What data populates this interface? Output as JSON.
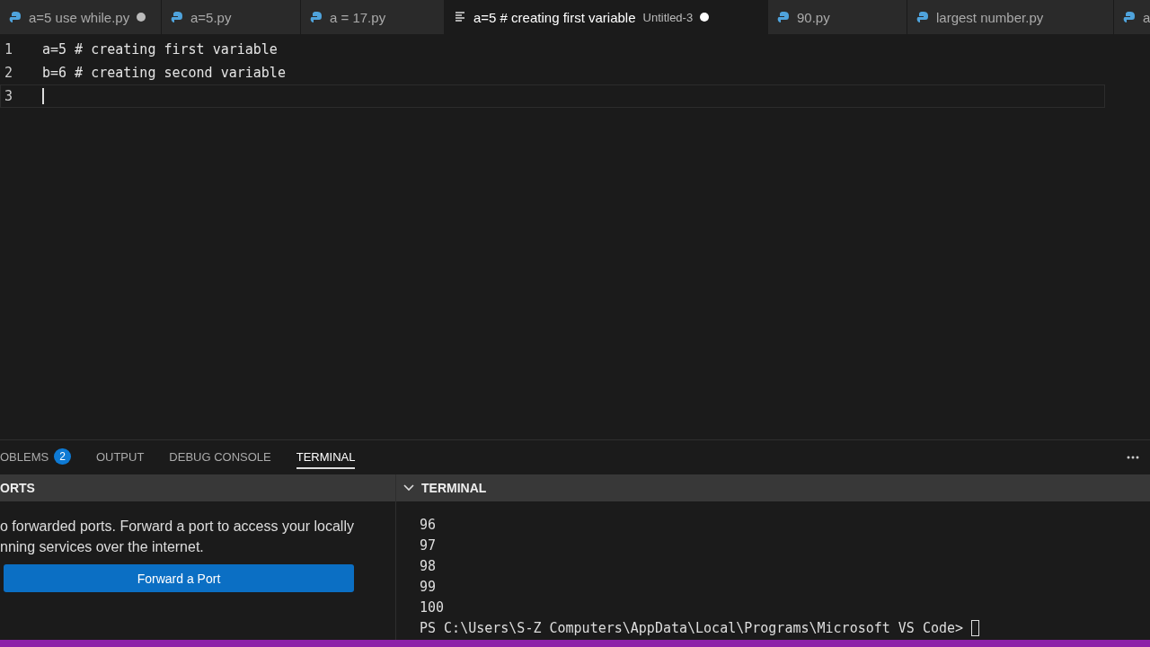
{
  "editor_tabs": [
    {
      "label": "a=5 use while.py",
      "kind": "python",
      "dirty": true,
      "selected": false
    },
    {
      "label": "a=5.py",
      "kind": "python",
      "dirty": false,
      "selected": false
    },
    {
      "label": "a = 17.py",
      "kind": "python",
      "dirty": false,
      "selected": false
    },
    {
      "label": "a=5 # creating first variable",
      "description": "Untitled-3",
      "kind": "text",
      "dirty": true,
      "selected": true
    },
    {
      "label": "90.py",
      "kind": "python",
      "dirty": false,
      "selected": false
    },
    {
      "label": "largest number.py",
      "kind": "python",
      "dirty": false,
      "selected": false
    },
    {
      "label": "a",
      "kind": "python",
      "dirty": false,
      "selected": false
    }
  ],
  "code_lines": [
    {
      "number": "1",
      "text": "a=5 # creating first variable",
      "current": false
    },
    {
      "number": "2",
      "text": "b=6 # creating second variable",
      "current": false
    },
    {
      "number": "3",
      "current": true
    }
  ],
  "panel_tabs": [
    {
      "label": "OBLEMS",
      "badge": "2",
      "selected": false
    },
    {
      "label": "OUTPUT",
      "selected": false
    },
    {
      "label": "DEBUG CONSOLE",
      "selected": false
    },
    {
      "label": "TERMINAL",
      "selected": true
    }
  ],
  "ports": {
    "title": "ORTS",
    "message_lines": [
      "o forwarded ports. Forward a port to access your locally",
      "nning services over the internet."
    ],
    "button": "Forward a Port"
  },
  "terminal": {
    "title": "TERMINAL",
    "expanded": true,
    "lines": [
      "96",
      "97",
      "98",
      "99",
      "100",
      "PS C:\\Users\\S-Z Computers\\AppData\\Local\\Programs\\Microsoft VS Code> "
    ]
  }
}
